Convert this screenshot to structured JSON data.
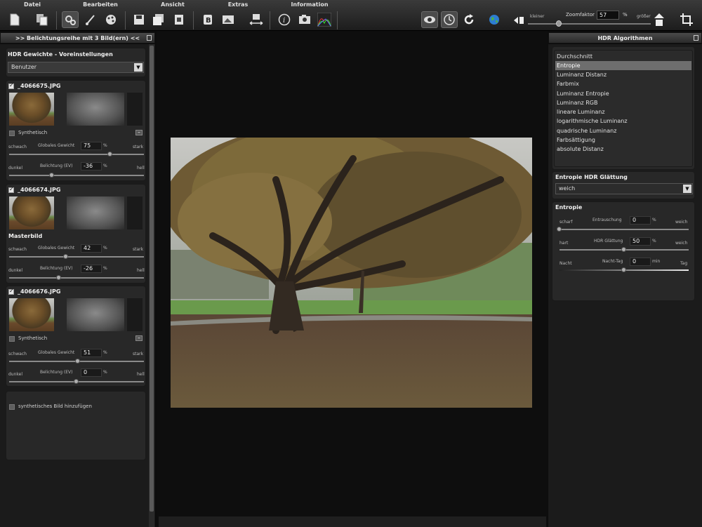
{
  "menu": [
    "Datei",
    "Bearbeiten",
    "Ansicht",
    "Extras",
    "Information"
  ],
  "toolbar": {
    "zoom_label": "Zoomfaktor",
    "zoom_value": "57",
    "zoom_unit": "%",
    "zoom_smaller": "kleiner",
    "zoom_bigger": "größer",
    "zoom_level": 0.25,
    "icons": [
      "new-document-icon",
      "copy-document-icon",
      "settings-gears-icon",
      "brush-icon",
      "palette-icon",
      "save-icon",
      "save-all-icon",
      "export-icon",
      "bold-b-icon",
      "image-convert-icon",
      "resize-icon",
      "info-icon",
      "camera-exif-icon",
      "histogram-icon",
      "eye-icon",
      "clock-compare-icon",
      "refresh-icon",
      "globe-icon",
      "zoom-out-icon",
      "zoom-in-icon",
      "crop-rotate-icon"
    ]
  },
  "left": {
    "header": ">> Belichtungsreihe mit 3 Bild(ern) <<",
    "weights_title": "HDR Gewichte - Voreinstellungen",
    "weights_select": "Benutzer",
    "images": [
      {
        "filename": "_4066675.JPG",
        "synthetic_label": "Synthetisch",
        "weak": "schwach",
        "strong": "stark",
        "global_label": "Globales Gewicht",
        "global_value": "75",
        "global_unit": "%",
        "global_level": 0.75,
        "dark": "dunkel",
        "bright": "hell",
        "exposure_label": "Belichtung (EV)",
        "exposure_value": "-36",
        "exposure_unit": "%",
        "exposure_level": 0.32
      },
      {
        "filename": "_4066674.JPG",
        "master_label": "Masterbild",
        "weak": "schwach",
        "strong": "stark",
        "global_label": "Globales Gewicht",
        "global_value": "42",
        "global_unit": "%",
        "global_level": 0.42,
        "dark": "dunkel",
        "bright": "hell",
        "exposure_label": "Belichtung (EV)",
        "exposure_value": "-26",
        "exposure_unit": "%",
        "exposure_level": 0.37
      },
      {
        "filename": "_4066676.JPG",
        "synthetic_label": "Synthetisch",
        "weak": "schwach",
        "strong": "stark",
        "global_label": "Globales Gewicht",
        "global_value": "51",
        "global_unit": "%",
        "global_level": 0.51,
        "dark": "dunkel",
        "bright": "hell",
        "exposure_label": "Belichtung (EV)",
        "exposure_value": "0",
        "exposure_unit": "%",
        "exposure_level": 0.5
      }
    ],
    "add_synthetic": "synthetisches Bild hinzufügen"
  },
  "right": {
    "header": "HDR Algorithmen",
    "algorithms": [
      "Durchschnitt",
      "Entropie",
      "Luminanz Distanz",
      "Farbmix",
      "Luminanz Entropie",
      "Luminanz RGB",
      "lineare Luminanz",
      "logarithmische Luminanz",
      "quadrische Luminanz",
      "Farbsättigung",
      "absolute Distanz"
    ],
    "selected_index": 1,
    "smoothing_title": "Entropie HDR Glättung",
    "smoothing_value": "weich",
    "entropy_title": "Entropie",
    "rows": [
      {
        "left": "scharf",
        "label": "Entrauschung",
        "value": "0",
        "unit": "%",
        "right": "weich",
        "level": 0.0
      },
      {
        "left": "hart",
        "label": "HDR Glättung",
        "value": "50",
        "unit": "%",
        "right": "weich",
        "level": 0.5
      },
      {
        "left": "Nacht",
        "label": "Nacht-Tag",
        "value": "0",
        "unit": "min",
        "right": "Tag",
        "level": 0.5
      }
    ]
  }
}
